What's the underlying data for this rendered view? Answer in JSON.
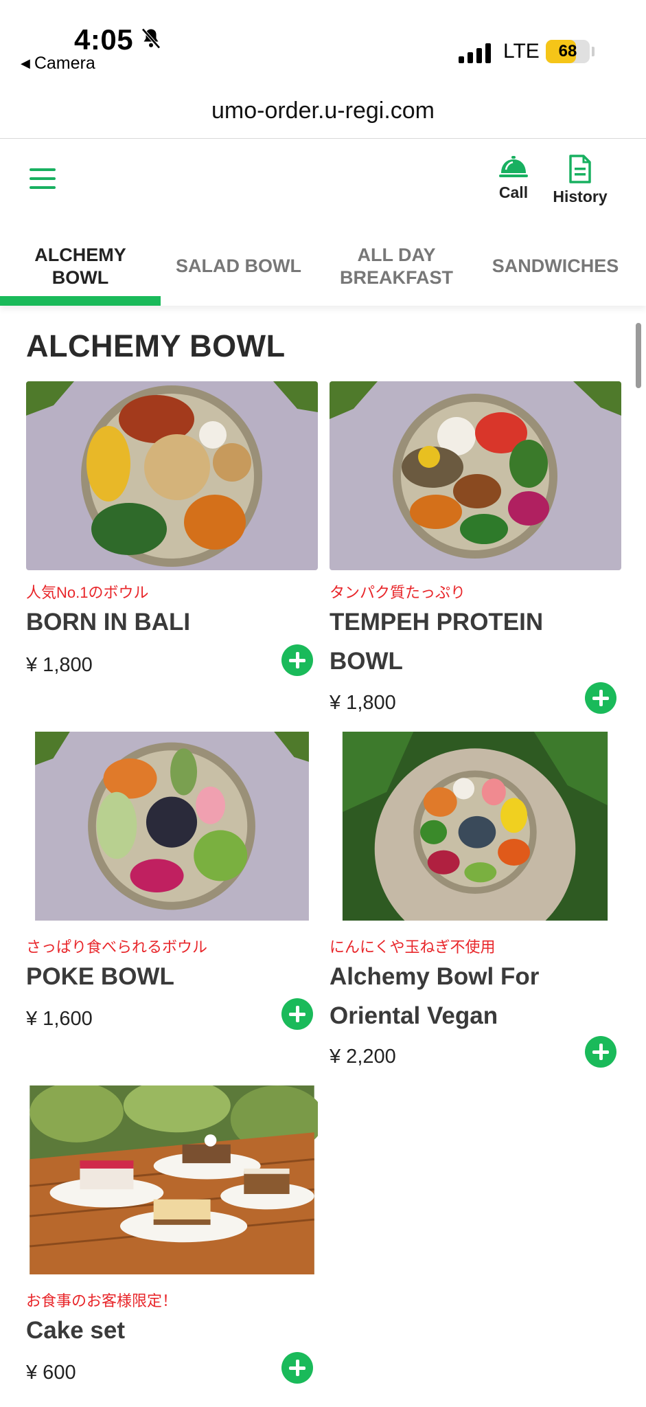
{
  "status_bar": {
    "time": "4:05",
    "back_app": "Camera",
    "network": "LTE",
    "battery_percent": "68",
    "battery_level": 0.68
  },
  "browser": {
    "url": "umo-order.u-regi.com"
  },
  "header": {
    "call_label": "Call",
    "history_label": "History",
    "accent_color": "#1aba5a"
  },
  "tabs": [
    {
      "label": "ALCHEMY BOWL",
      "active": true
    },
    {
      "label": "SALAD BOWL",
      "active": false
    },
    {
      "label": "ALL DAY BREAKFAST",
      "active": false
    },
    {
      "label": "SANDWICHES",
      "active": false
    }
  ],
  "section": {
    "title": "ALCHEMY BOWL"
  },
  "items": [
    {
      "tagline": "人気No.1のボウル",
      "name": "BORN IN BALI",
      "price": "¥ 1,800",
      "image": "bowl-image"
    },
    {
      "tagline": "タンパク質たっぷり",
      "name": "TEMPEH PROTEIN BOWL",
      "price": "¥ 1,800",
      "image": "bowl-image"
    },
    {
      "tagline": "さっぱり食べられるボウル",
      "name": "POKE BOWL",
      "price": "¥ 1,600",
      "image": "bowl-image"
    },
    {
      "tagline": "にんにくや玉ねぎ不使用",
      "name": "Alchemy Bowl For Oriental Vegan",
      "price": "¥ 2,200",
      "image": "bowl-image"
    },
    {
      "tagline": "お食事のお客様限定！",
      "name": "Cake set",
      "price": "¥ 600",
      "image": "cake-image"
    }
  ]
}
